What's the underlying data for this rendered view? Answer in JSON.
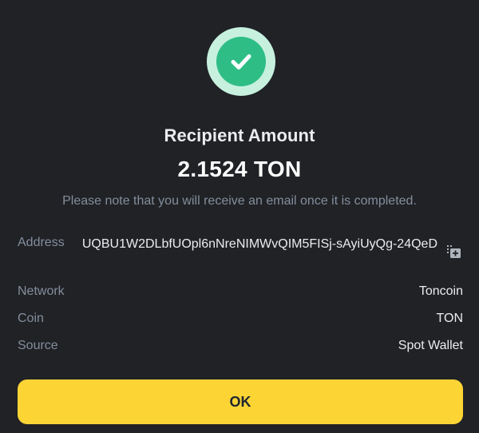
{
  "dialog": {
    "status_icon": "check-circle-icon",
    "title": "Recipient Amount",
    "amount": "2.1524 TON",
    "note": "Please note that you will receive an email once it is completed."
  },
  "details": {
    "address_label": "Address",
    "address_value": "UQBU1W2DLbfUOpl6nNreNIMWvQIM5FISj-sAyiUyQg-24QeD",
    "copy_icon": "copy-icon",
    "network_label": "Network",
    "network_value": "Toncoin",
    "coin_label": "Coin",
    "coin_value": "TON",
    "source_label": "Source",
    "source_value": "Spot Wallet"
  },
  "actions": {
    "ok_label": "OK"
  },
  "colors": {
    "background": "#202226",
    "accent": "#fcd535",
    "success": "#2ebd85",
    "muted_text": "#848e9c"
  }
}
